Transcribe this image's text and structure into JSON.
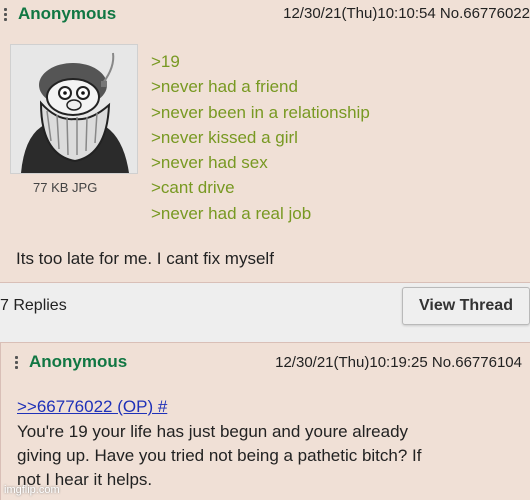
{
  "op": {
    "name": "Anonymous",
    "meta": "12/30/21(Thu)10:10:54 No.66776022",
    "file_info": "77 KB JPG",
    "greentext": [
      ">19",
      ">never had a friend",
      ">never been in a relationship",
      ">never kissed a girl",
      ">never had sex",
      ">cant drive",
      ">never had a real job"
    ],
    "body": "Its too late for me. I cant fix myself"
  },
  "footer": {
    "replies": "7 Replies",
    "view_thread": "View Thread"
  },
  "reply": {
    "name": "Anonymous",
    "meta": "12/30/21(Thu)10:19:25 No.66776104",
    "quotelink": ">>66776022 (OP) #",
    "lines": [
      "You're 19 your life has just begun and youre already",
      "giving up. Have you tried not being a pathetic bitch? If",
      "not I hear it helps."
    ]
  },
  "watermark": "imgflip.com",
  "colors": {
    "post_bg": "#f0e0d6",
    "name": "#117743",
    "greentext": "#789922",
    "quotelink": "#1f31b8"
  }
}
